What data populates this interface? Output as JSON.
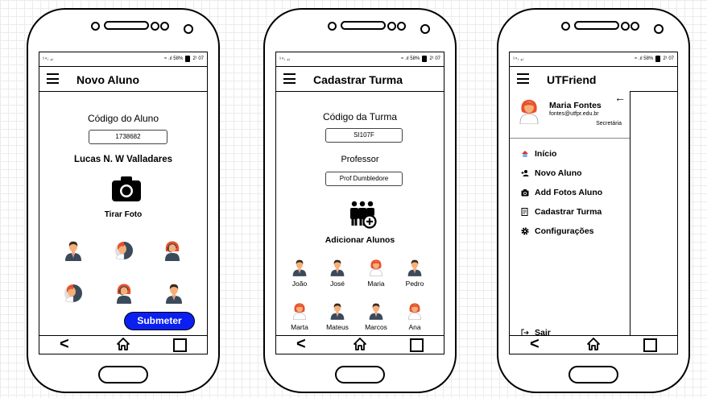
{
  "status": {
    "left": "¹⁴ₗ ₄ₗ",
    "right": "≈ .ıl 58%",
    "time": "2¹ 07"
  },
  "nav": {
    "back": "<"
  },
  "phone1": {
    "title": "Novo Aluno",
    "code_label": "Código do Aluno",
    "code_value": "1738682",
    "student_name": "Lucas N. W Valladares",
    "photo_label": "Tirar Foto",
    "submit_label": "Submeter"
  },
  "phone2": {
    "title": "Cadastrar Turma",
    "code_label": "Código da Turma",
    "code_value": "SI107F",
    "professor_label": "Professor",
    "professor_value": "Prof Dumbledore",
    "add_label": "Adicionar Alunos",
    "students": [
      "João",
      "José",
      "Maria",
      "Pedro",
      "Marta",
      "Mateus",
      "Marcos",
      "Ana"
    ]
  },
  "phone3": {
    "title": "UTFriend",
    "user_name": "Maria Fontes",
    "user_email": "fontes@utfpr.edu.br",
    "user_role": "Secretária",
    "menu": [
      "Início",
      "Novo Aluno",
      "Add Fotos Aluno",
      "Cadastrar Turma",
      "Configurações"
    ],
    "logout": "Sair",
    "back_arrow": "←"
  },
  "colors": {
    "submit_button": "#0a1ff0",
    "avatar_skin": "#f5b07a",
    "avatar_suit": "#3b4a5a",
    "avatar_female_hair": "#e8512c"
  },
  "icons": [
    "hamburger-icon",
    "camera-icon",
    "add-group-icon",
    "home-icon",
    "add-user-icon",
    "add-photo-icon",
    "register-class-icon",
    "gear-icon",
    "logout-icon",
    "back-arrow-icon"
  ]
}
